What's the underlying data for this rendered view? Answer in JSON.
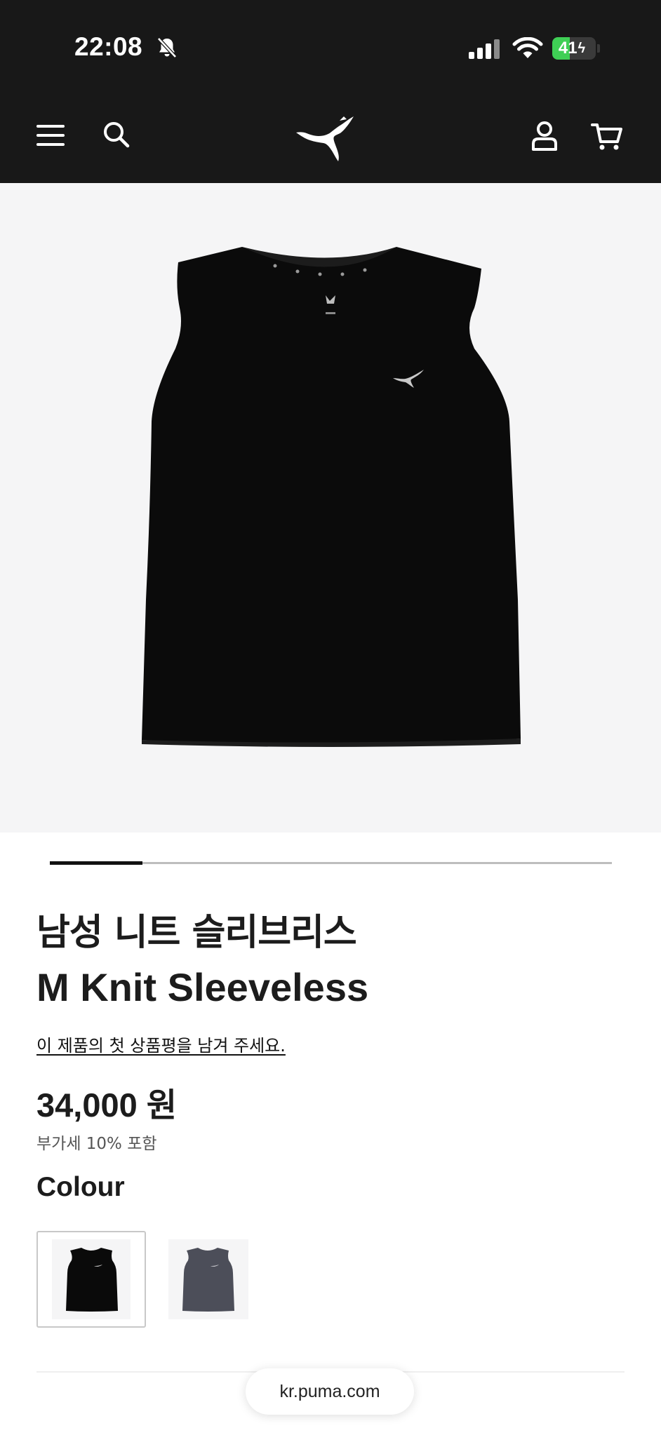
{
  "status_bar": {
    "time": "22:08",
    "battery_level": "41",
    "icons": [
      "bell-off-icon",
      "cellular-signal-icon",
      "wifi-icon",
      "battery-charging-icon"
    ]
  },
  "header": {
    "icons": [
      "menu-icon",
      "search-icon",
      "puma-logo",
      "account-icon",
      "cart-icon"
    ]
  },
  "carousel": {
    "current_progress": 0.165
  },
  "product": {
    "title_ko": "남성 니트 슬리브리스",
    "title_en": "M Knit Sleeveless",
    "review_link": "이 제품의 첫 상품평을 남겨 주세요.",
    "price": "34,000 원",
    "vat_note": "부가세 10% 포함",
    "colour_label": "Colour",
    "colours": [
      {
        "name": "black",
        "hex": "#0a0a0a",
        "selected": true
      },
      {
        "name": "grey",
        "hex": "#4c4e59",
        "selected": false
      }
    ]
  },
  "browser": {
    "url": "kr.puma.com"
  },
  "colors": {
    "header_bg": "#181818",
    "image_bg": "#f5f5f6",
    "battery_green": "#3fcf55"
  }
}
